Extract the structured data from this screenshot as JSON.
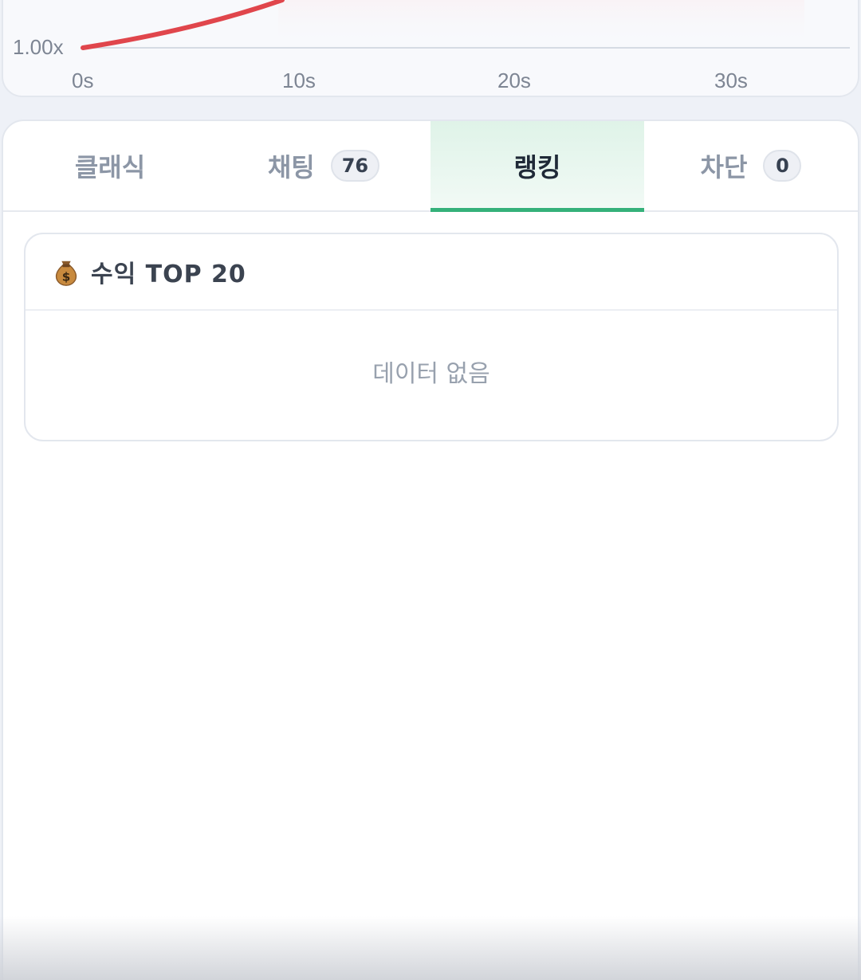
{
  "chart": {
    "y_label": "1.00x",
    "x_ticks": [
      "0s",
      "10s",
      "20s",
      "30s"
    ],
    "line_color": "#e0464c"
  },
  "tabs": [
    {
      "label": "클래식",
      "badge": null,
      "active": false
    },
    {
      "label": "채팅",
      "badge": "76",
      "active": false
    },
    {
      "label": "랭킹",
      "badge": null,
      "active": true
    },
    {
      "label": "차단",
      "badge": "0",
      "active": false
    }
  ],
  "ranking": {
    "icon": "money-bag-icon",
    "title": "수익 TOP 20",
    "empty_text": "데이터 없음"
  },
  "colors": {
    "accent": "#35b17a",
    "active_tab_bg": "#dff3e8"
  }
}
